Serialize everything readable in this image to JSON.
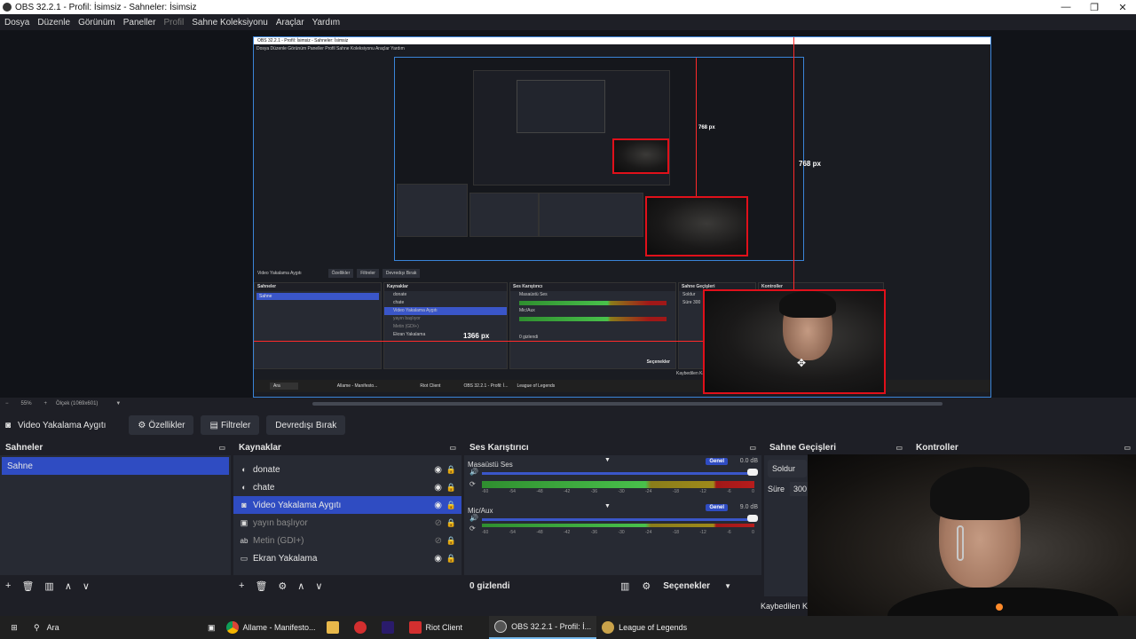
{
  "window": {
    "title": "OBS 32.2.1 - Profil: İsimsiz - Sahneler: İsimsiz",
    "controls": [
      "—",
      "❐",
      "✕"
    ]
  },
  "menu": {
    "items": [
      "Dosya",
      "Düzenle",
      "Görünüm",
      "Paneller",
      "Profil",
      "Sahne Koleksiyonu",
      "Araçlar",
      "Yardım"
    ]
  },
  "preview": {
    "label_768": "768 px",
    "label_768_small": "768 px",
    "label_1366": "1366 px",
    "mini_title": "OBS 32.2.1 - Profil: İsimsiz - Sahneler: İsimsiz",
    "mini_menu": "Dosya  Düzenle  Görünüm  Paneller  Profil  Sahne Koleksiyonu  Araçlar  Yardım",
    "mini_source": "Video Yakalama Aygıtı",
    "mini_buttons": [
      "Özellikler",
      "Filtreler",
      "Devredışı Bırak"
    ],
    "mini_panels": {
      "scenes": "Sahneler",
      "sources": "Kaynaklar",
      "mixer": "Ses Karıştırıcı",
      "transitions": "Sahne Geçişleri",
      "controls": "Kontroller"
    },
    "mini_scene": "Sahne",
    "mini_sources": [
      "donate",
      "chate",
      "Video Yakalama Aygıtı",
      "yayın başlıyor",
      "Metin (GDI+)",
      "Ekran Yakalama"
    ],
    "mini_mixer": [
      "Masaüstü Ses",
      "Mic/Aux"
    ],
    "mini_hidden": "0 gizlendi",
    "mini_options": "Seçenekler",
    "mini_fade": "Soldur",
    "mini_duration": "Süre",
    "mini_duration_val": "300",
    "mini_lost": "Kaybedilen Ka",
    "mini_taskbar": {
      "search": "Ara",
      "items": [
        "Allame - Manifesto...",
        "Riot Client",
        "OBS 32.2.1 - Profil: İ...",
        "League of Legends"
      ]
    }
  },
  "scrollbar": {
    "zoom": "55%",
    "scale": "Ölçek (1069x601)"
  },
  "toolbar": {
    "source_name": "Video Yakalama Aygıtı",
    "properties": "Özellikler",
    "filters": "Filtreler",
    "disable": "Devredışı Bırak"
  },
  "scenes_dock": {
    "title": "Sahneler",
    "items": [
      "Sahne"
    ]
  },
  "sources_dock": {
    "title": "Kaynaklar",
    "items": [
      {
        "name": "donate",
        "icon": "globe-icon",
        "visible": true,
        "dim": false
      },
      {
        "name": "chate",
        "icon": "globe-icon",
        "visible": true,
        "dim": false
      },
      {
        "name": "Video Yakalama Aygıtı",
        "icon": "camera-icon",
        "visible": true,
        "dim": false
      },
      {
        "name": "yayın başlıyor",
        "icon": "image-icon",
        "visible": false,
        "dim": true
      },
      {
        "name": "Metin (GDI+)",
        "icon": "text-icon",
        "visible": false,
        "dim": true
      },
      {
        "name": "Ekran Yakalama",
        "icon": "monitor-icon",
        "visible": true,
        "dim": false
      }
    ],
    "text_icon": "ab"
  },
  "mixer_dock": {
    "title": "Ses Karıştırıcı",
    "channels": [
      {
        "name": "Masaüstü Ses",
        "badge": "Genel",
        "db": "0.0 dB",
        "volume_pct": 100
      },
      {
        "name": "Mic/Aux",
        "badge": "Genel",
        "db": "9.0 dB",
        "volume_pct": 100
      }
    ],
    "scale": [
      "-60",
      "-54",
      "-48",
      "-42",
      "-36",
      "-30",
      "-24",
      "-18",
      "-12",
      "-6",
      "0"
    ],
    "hidden": "0 gizlendi",
    "options": "Seçenekler"
  },
  "transitions_dock": {
    "title": "Sahne Geçişleri",
    "fade": "Soldur",
    "duration_label": "Süre",
    "duration_value": "300 r"
  },
  "controls_dock": {
    "title": "Kontroller"
  },
  "status": {
    "lost": "Kaybedilen Ka"
  },
  "taskbar": {
    "search": "Ara",
    "items": [
      {
        "label": "Allame - Manifesto...",
        "icon": "chrome-icon",
        "color": "#4caf50"
      },
      {
        "label": "",
        "icon": "folder-icon",
        "color": "#e8b84a"
      },
      {
        "label": "",
        "icon": "riot-app-icon",
        "color": "#d32f2f"
      },
      {
        "label": "",
        "icon": "premiere-icon",
        "color": "#2a1b6b"
      },
      {
        "label": "Riot Client",
        "icon": "riot-client-icon",
        "color": "#d32f2f"
      },
      {
        "label": "OBS 32.2.1 - Profil: İ...",
        "icon": "obs-icon",
        "color": "#555555"
      },
      {
        "label": "League of Legends",
        "icon": "lol-icon",
        "color": "#c9a24a"
      }
    ]
  },
  "colors": {
    "accent": "#2f4cc2",
    "selection_red": "#e0101a",
    "preview_border": "#3a84d8"
  }
}
